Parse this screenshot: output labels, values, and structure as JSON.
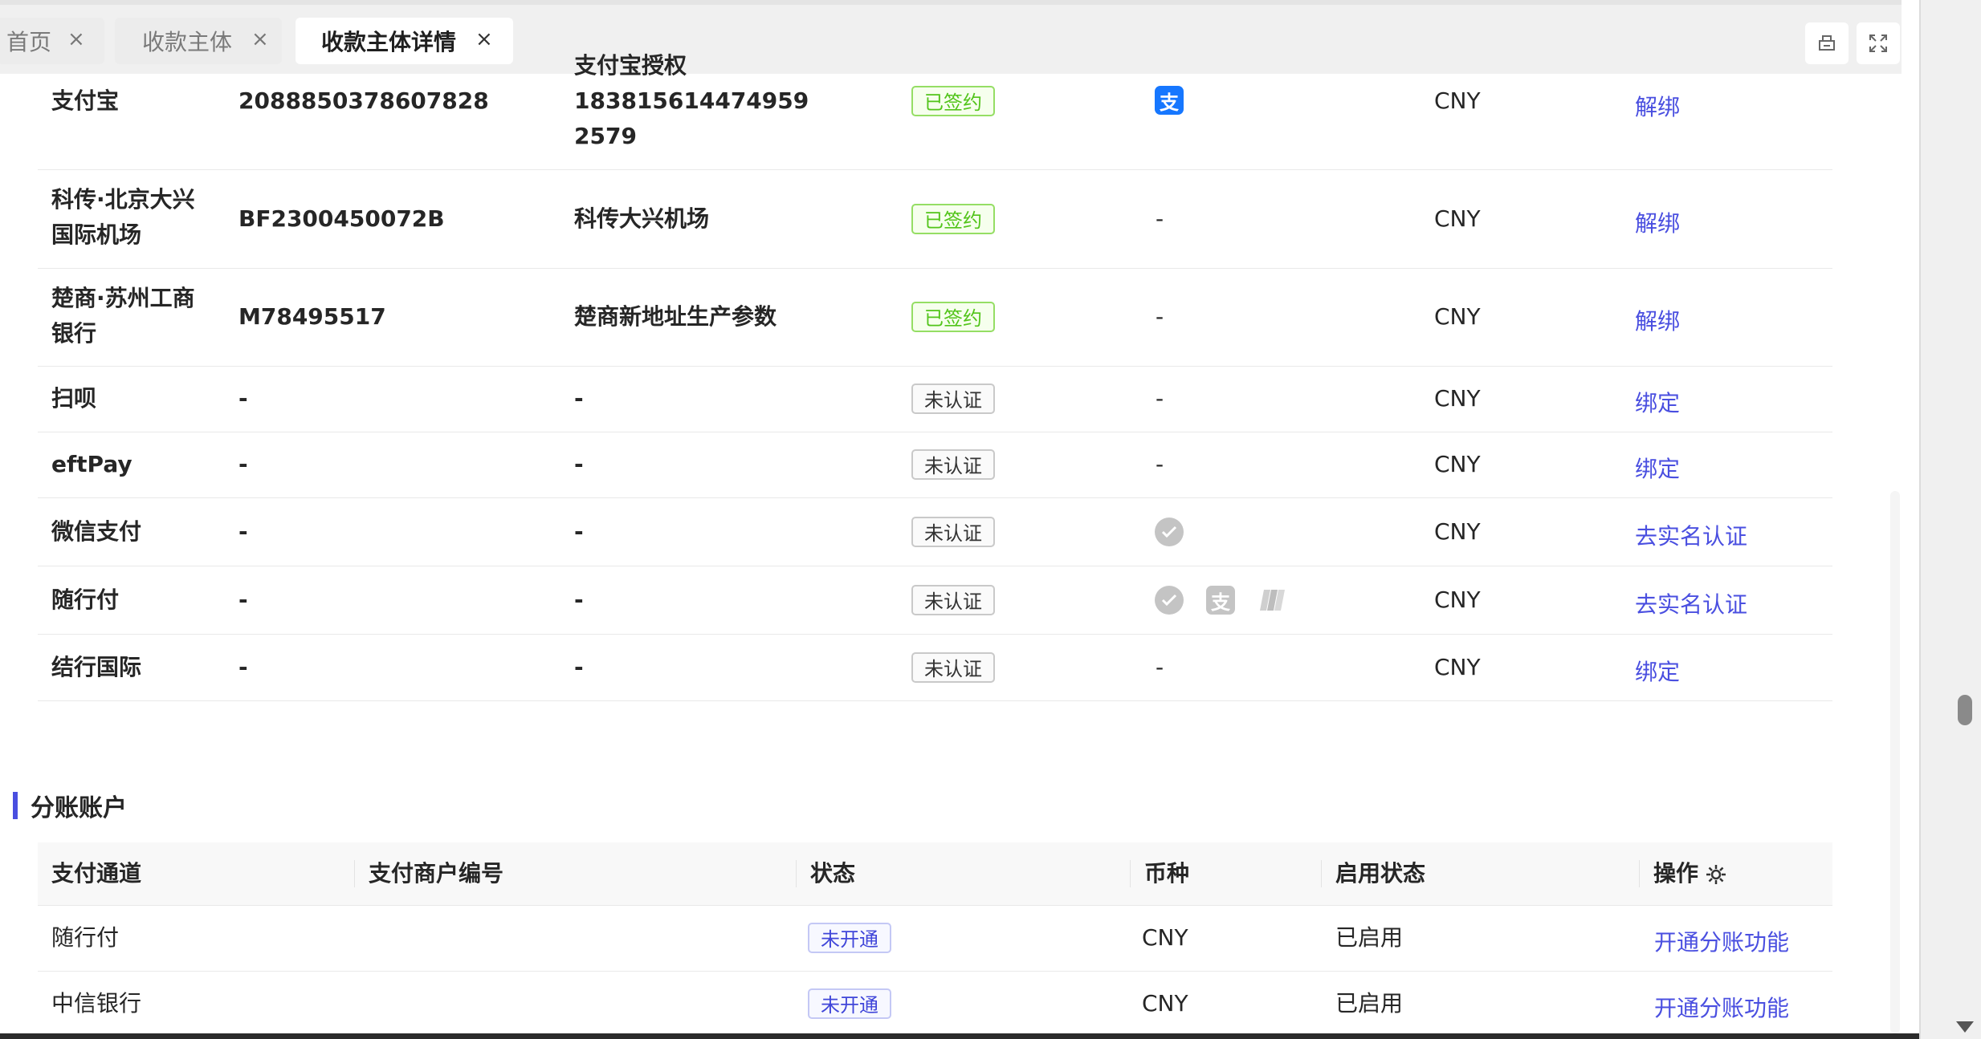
{
  "tabs": [
    {
      "label": "首页",
      "close": "×"
    },
    {
      "label": "收款主体",
      "close": "×"
    },
    {
      "label": "收款主体详情",
      "close": "×"
    }
  ],
  "channels_table": {
    "rows": [
      {
        "name": "支付宝",
        "merchant_no": "2088850378607828",
        "merchant_name_lines": [
          "支付宝授权",
          "183815614474959",
          "2579"
        ],
        "status": "已签约",
        "status_kind": "green",
        "pay_methods": [
          "alipay-icon"
        ],
        "currency": "CNY",
        "action": "解绑"
      },
      {
        "name_lines": [
          "科传·北京大兴",
          "国际机场"
        ],
        "merchant_no": "BF2300450072B",
        "merchant_name": "科传大兴机场",
        "status": "已签约",
        "status_kind": "green",
        "pay_methods_text": "-",
        "currency": "CNY",
        "action": "解绑"
      },
      {
        "name_lines": [
          "楚商·苏州工商",
          "银行"
        ],
        "merchant_no": "M78495517",
        "merchant_name": "楚商新地址生产参数",
        "status": "已签约",
        "status_kind": "green",
        "pay_methods_text": "-",
        "currency": "CNY",
        "action": "解绑"
      },
      {
        "name": "扫呗",
        "merchant_no": "-",
        "merchant_name": "-",
        "status": "未认证",
        "status_kind": "gray",
        "pay_methods_text": "-",
        "currency": "CNY",
        "action": "绑定"
      },
      {
        "name": "eftPay",
        "merchant_no": "-",
        "merchant_name": "-",
        "status": "未认证",
        "status_kind": "gray",
        "pay_methods_text": "-",
        "currency": "CNY",
        "action": "绑定"
      },
      {
        "name": "微信支付",
        "merchant_no": "-",
        "merchant_name": "-",
        "status": "未认证",
        "status_kind": "gray",
        "pay_methods": [
          "wechat-icon"
        ],
        "currency": "CNY",
        "action": "去实名认证"
      },
      {
        "name": "随行付",
        "merchant_no": "-",
        "merchant_name": "-",
        "status": "未认证",
        "status_kind": "gray",
        "pay_methods": [
          "wechat-icon",
          "alipay-icon",
          "unionpay-icon"
        ],
        "currency": "CNY",
        "action": "去实名认证"
      },
      {
        "name": "结行国际",
        "merchant_no": "-",
        "merchant_name": "-",
        "status": "未认证",
        "status_kind": "gray",
        "pay_methods_text": "-",
        "currency": "CNY",
        "action": "绑定"
      }
    ]
  },
  "split_section": {
    "title": "分账账户",
    "headers": [
      "支付通道",
      "支付商户编号",
      "状态",
      "币种",
      "启用状态",
      "操作"
    ],
    "rows": [
      {
        "channel": "随行付",
        "merchant_no": "",
        "status": "未开通",
        "currency": "CNY",
        "enabled": "已启用",
        "action": "开通分账功能"
      },
      {
        "channel": "中信银行",
        "merchant_no": "",
        "status": "未开通",
        "currency": "CNY",
        "enabled": "已启用",
        "action": "开通分账功能"
      }
    ]
  },
  "colors": {
    "accent": "#4a4fe0",
    "signed": "#52c41a",
    "alipay": "#1677ff"
  }
}
